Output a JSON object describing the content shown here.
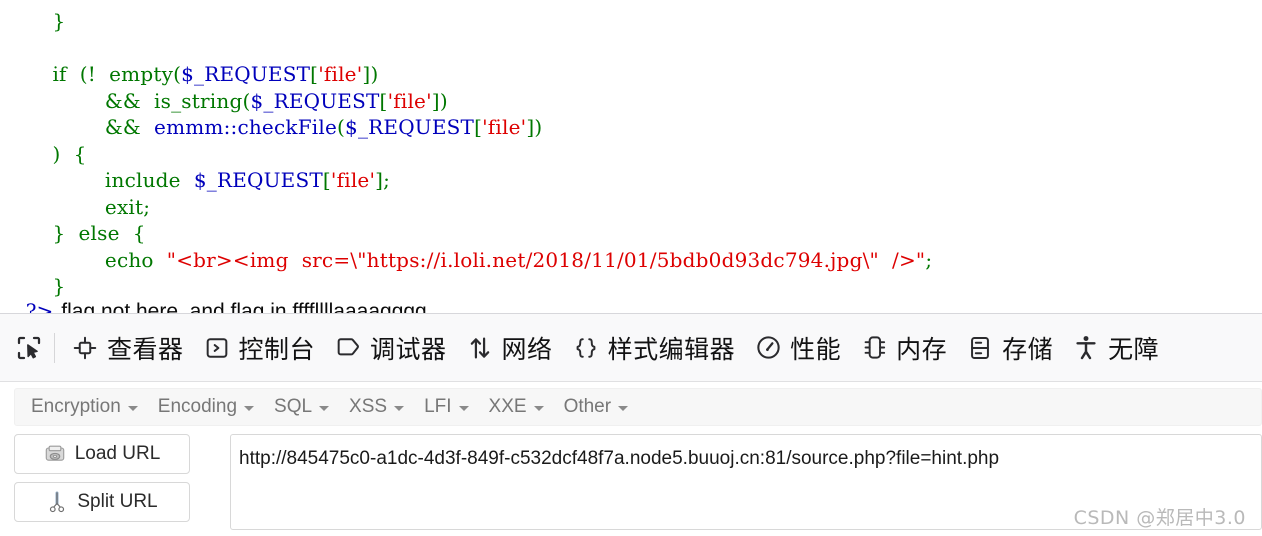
{
  "page": {
    "code_lines": [
      [
        {
          "t": "        }",
          "c": "green"
        }
      ],
      [
        {
          "t": "",
          "c": "black"
        }
      ],
      [
        {
          "t": "        if  (!  empty",
          "c": "green"
        },
        {
          "t": "(",
          "c": "green"
        },
        {
          "t": "$_REQUEST",
          "c": "blue"
        },
        {
          "t": "[",
          "c": "green"
        },
        {
          "t": "'file'",
          "c": "red"
        },
        {
          "t": "]",
          "c": "green"
        },
        {
          "t": ")",
          "c": "green"
        }
      ],
      [
        {
          "t": "                &&  is_string",
          "c": "green"
        },
        {
          "t": "(",
          "c": "green"
        },
        {
          "t": "$_REQUEST",
          "c": "blue"
        },
        {
          "t": "[",
          "c": "green"
        },
        {
          "t": "'file'",
          "c": "red"
        },
        {
          "t": "]",
          "c": "green"
        },
        {
          "t": ")",
          "c": "green"
        }
      ],
      [
        {
          "t": "                &&  ",
          "c": "green"
        },
        {
          "t": "emmm::checkFile",
          "c": "blue"
        },
        {
          "t": "(",
          "c": "green"
        },
        {
          "t": "$_REQUEST",
          "c": "blue"
        },
        {
          "t": "[",
          "c": "green"
        },
        {
          "t": "'file'",
          "c": "red"
        },
        {
          "t": "]",
          "c": "green"
        },
        {
          "t": ")",
          "c": "green"
        }
      ],
      [
        {
          "t": "        )  {",
          "c": "green"
        }
      ],
      [
        {
          "t": "                include  ",
          "c": "green"
        },
        {
          "t": "$_REQUEST",
          "c": "blue"
        },
        {
          "t": "[",
          "c": "green"
        },
        {
          "t": "'file'",
          "c": "red"
        },
        {
          "t": "]",
          "c": "green"
        },
        {
          "t": ";",
          "c": "green"
        }
      ],
      [
        {
          "t": "                exit;",
          "c": "green"
        }
      ],
      [
        {
          "t": "        }  else  {",
          "c": "green"
        }
      ],
      [
        {
          "t": "                echo  ",
          "c": "green"
        },
        {
          "t": "\"<br><img  src=\\\"https://i.loli.net/2018/11/01/5bdb0d93dc794.jpg\\\"  />\"",
          "c": "red"
        },
        {
          "t": ";",
          "c": "green"
        }
      ],
      [
        {
          "t": "        }",
          "c": "green"
        }
      ]
    ],
    "php_close_tag": "?>",
    "output_text": "flag not here, and flag in ffffllllaaaagggg"
  },
  "devtools": {
    "picker_icon": "element-picker-icon",
    "tabs": [
      {
        "label": "查看器",
        "icon": "inspector-icon",
        "name": "tab-inspector"
      },
      {
        "label": "控制台",
        "icon": "console-icon",
        "name": "tab-console"
      },
      {
        "label": "调试器",
        "icon": "debugger-icon",
        "name": "tab-debugger"
      },
      {
        "label": "网络",
        "icon": "network-arrows-icon",
        "name": "tab-network"
      },
      {
        "label": "样式编辑器",
        "icon": "style-editor-icon",
        "name": "tab-style-editor"
      },
      {
        "label": "性能",
        "icon": "performance-gauge-icon",
        "name": "tab-performance"
      },
      {
        "label": "内存",
        "icon": "memory-icon",
        "name": "tab-memory"
      },
      {
        "label": "存储",
        "icon": "storage-icon",
        "name": "tab-storage"
      },
      {
        "label": "无障",
        "icon": "accessibility-icon",
        "name": "tab-accessibility"
      }
    ]
  },
  "hackbar": {
    "menus": [
      {
        "label": "Encryption",
        "name": "menu-encryption"
      },
      {
        "label": "Encoding",
        "name": "menu-encoding"
      },
      {
        "label": "SQL",
        "name": "menu-sql"
      },
      {
        "label": "XSS",
        "name": "menu-xss"
      },
      {
        "label": "LFI",
        "name": "menu-lfi"
      },
      {
        "label": "XXE",
        "name": "menu-xxe"
      },
      {
        "label": "Other",
        "name": "menu-other"
      }
    ],
    "load_url_label": "Load URL",
    "split_url_label": "Split URL",
    "load_url_icon": "disk-drive-icon",
    "split_url_icon": "scissors-icon",
    "url_value": "http://845475c0-a1dc-4d3f-849f-c532dcf48f7a.node5.buuoj.cn:81/source.php?file=hint.php"
  },
  "watermark": "CSDN @郑居中3.0",
  "colors": {
    "php_keyword_green": "#007700",
    "php_variable_blue": "#0000bb",
    "php_string_red": "#dd0000",
    "devtools_bg": "#f9f9fa",
    "hackbar_menubar_bg": "#f7f7f7",
    "watermark_gray": "#b9b9b9"
  }
}
